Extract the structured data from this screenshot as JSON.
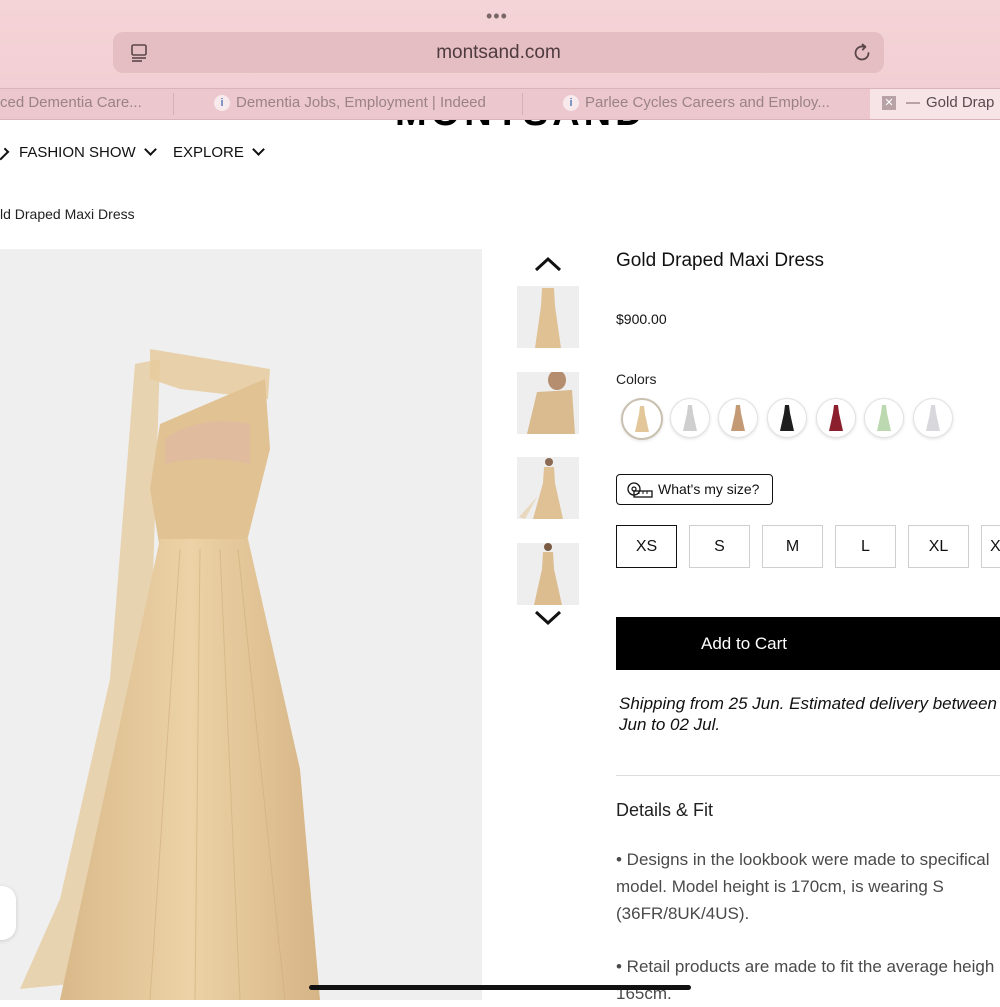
{
  "browser": {
    "url": "montsand.com",
    "tabs": [
      {
        "title": "ced Dementia Care..."
      },
      {
        "title": "Dementia Jobs, Employment | Indeed"
      },
      {
        "title": "Parlee Cycles Careers and Employ..."
      },
      {
        "title": "Gold Drap"
      }
    ]
  },
  "site": {
    "logo": "MONTSAND",
    "nav": [
      {
        "label": "FASHION SHOW"
      },
      {
        "label": "EXPLORE"
      }
    ],
    "breadcrumb": "ld Draped Maxi Dress"
  },
  "product": {
    "title": "Gold Draped Maxi Dress",
    "price": "$900.00",
    "colors_label": "Colors",
    "colors": [
      {
        "name": "gold",
        "hex": "#e3c79a",
        "selected": true
      },
      {
        "name": "silver",
        "hex": "#cfcfcf"
      },
      {
        "name": "bronze",
        "hex": "#c49a74"
      },
      {
        "name": "black",
        "hex": "#1e1e1e"
      },
      {
        "name": "burgundy",
        "hex": "#8c1f2e"
      },
      {
        "name": "mint",
        "hex": "#bcd8b0"
      },
      {
        "name": "light-grey",
        "hex": "#d8d8dc"
      }
    ],
    "size_guide_label": "What's my size?",
    "sizes": [
      {
        "label": "XS",
        "selected": true
      },
      {
        "label": "S"
      },
      {
        "label": "M"
      },
      {
        "label": "L"
      },
      {
        "label": "XL"
      },
      {
        "label": "X"
      }
    ],
    "add_to_cart": "Add to Cart",
    "shipping": "Shipping from 25 Jun. Estimated delivery between\nJun to 02 Jul.",
    "details_title": "Details & Fit",
    "details": [
      "• Designs in the lookbook were made to specifical\nmodel. Model height is 170cm, is wearing S\n(36FR/8UK/4US).",
      "• Retail products are made to fit the average heigh\n165cm."
    ]
  },
  "colors": {
    "chrome_bg": "#f1cfd4",
    "dress_gold": "#e3c79a",
    "cta_bg": "#000000"
  }
}
